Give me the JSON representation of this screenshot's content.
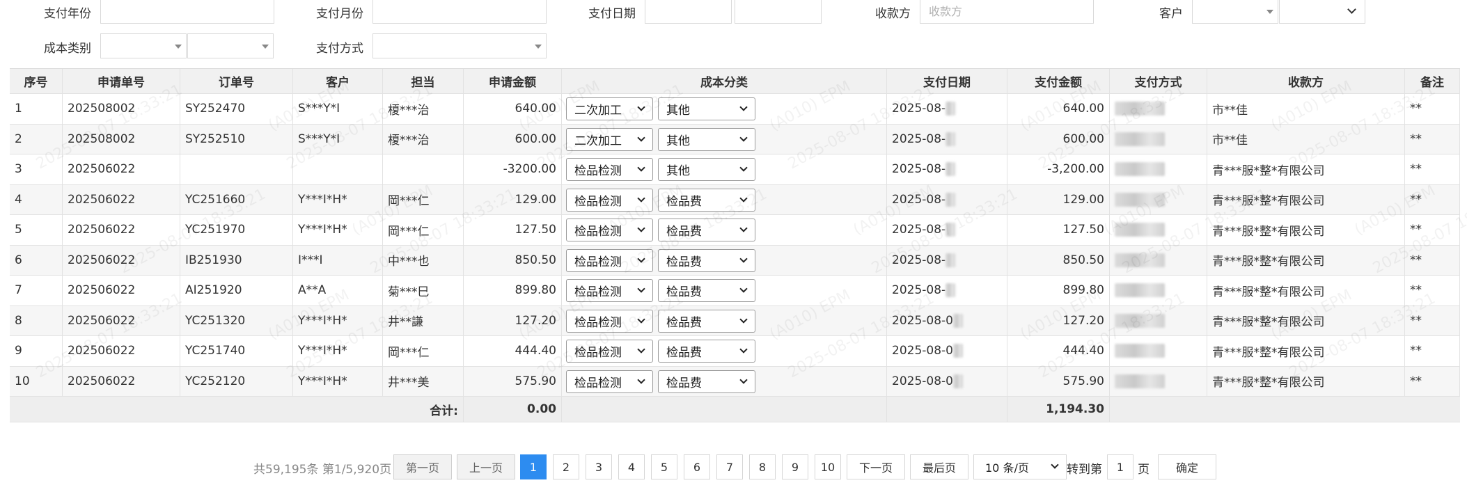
{
  "filters": {
    "pay_year_label": "支付年份",
    "pay_month_label": "支付月份",
    "pay_date_label": "支付日期",
    "payee_label": "收款方",
    "payee_placeholder": "收款方",
    "customer_label": "客户",
    "cost_category_label": "成本类别",
    "pay_method_label": "支付方式"
  },
  "table": {
    "headers": [
      "序号",
      "申请单号",
      "订单号",
      "客户",
      "担当",
      "申请金额",
      "成本分类",
      "支付日期",
      "支付金额",
      "支付方式",
      "收款方",
      "备注"
    ],
    "rows": [
      {
        "no": "1",
        "app_no": "202508002",
        "order_no": "SY252470",
        "customer": "S***Y*I",
        "owner": "榎***治",
        "amount": "640.00",
        "cat1": "二次加工",
        "cat2": "其他",
        "date": "2025-08-",
        "pay_amount": "640.00",
        "payee": "市**佳",
        "remark": "**"
      },
      {
        "no": "2",
        "app_no": "202508002",
        "order_no": "SY252510",
        "customer": "S***Y*I",
        "owner": "榎***治",
        "amount": "600.00",
        "cat1": "二次加工",
        "cat2": "其他",
        "date": "2025-08-",
        "pay_amount": "600.00",
        "payee": "市**佳",
        "remark": "**"
      },
      {
        "no": "3",
        "app_no": "202506022",
        "order_no": "",
        "customer": "",
        "owner": "",
        "amount": "-3200.00",
        "cat1": "检品检测",
        "cat2": "其他",
        "date": "2025-08-",
        "pay_amount": "-3,200.00",
        "payee": "青***服*整*有限公司",
        "remark": "**"
      },
      {
        "no": "4",
        "app_no": "202506022",
        "order_no": "YC251660",
        "customer": "Y***I*H*",
        "owner": "岡***仁",
        "amount": "129.00",
        "cat1": "检品检测",
        "cat2": "检品费",
        "date": "2025-08-",
        "pay_amount": "129.00",
        "payee": "青***服*整*有限公司",
        "remark": "**"
      },
      {
        "no": "5",
        "app_no": "202506022",
        "order_no": "YC251970",
        "customer": "Y***I*H*",
        "owner": "岡***仁",
        "amount": "127.50",
        "cat1": "检品检测",
        "cat2": "检品费",
        "date": "2025-08-",
        "pay_amount": "127.50",
        "payee": "青***服*整*有限公司",
        "remark": "**"
      },
      {
        "no": "6",
        "app_no": "202506022",
        "order_no": "IB251930",
        "customer": "I***I",
        "owner": "中***也",
        "amount": "850.50",
        "cat1": "检品检测",
        "cat2": "检品费",
        "date": "2025-08-",
        "pay_amount": "850.50",
        "payee": "青***服*整*有限公司",
        "remark": "**"
      },
      {
        "no": "7",
        "app_no": "202506022",
        "order_no": "AI251920",
        "customer": "A**A",
        "owner": "菊***巳",
        "amount": "899.80",
        "cat1": "检品检测",
        "cat2": "检品费",
        "date": "2025-08-",
        "pay_amount": "899.80",
        "payee": "青***服*整*有限公司",
        "remark": "**"
      },
      {
        "no": "8",
        "app_no": "202506022",
        "order_no": "YC251320",
        "customer": "Y***I*H*",
        "owner": "井**謙",
        "amount": "127.20",
        "cat1": "检品检测",
        "cat2": "检品费",
        "date": "2025-08-0",
        "pay_amount": "127.20",
        "payee": "青***服*整*有限公司",
        "remark": "**"
      },
      {
        "no": "9",
        "app_no": "202506022",
        "order_no": "YC251740",
        "customer": "Y***I*H*",
        "owner": "岡***仁",
        "amount": "444.40",
        "cat1": "检品检测",
        "cat2": "检品费",
        "date": "2025-08-0",
        "pay_amount": "444.40",
        "payee": "青***服*整*有限公司",
        "remark": "**"
      },
      {
        "no": "10",
        "app_no": "202506022",
        "order_no": "YC252120",
        "customer": "Y***I*H*",
        "owner": "井***美",
        "amount": "575.90",
        "cat1": "检品检测",
        "cat2": "检品费",
        "date": "2025-08-0",
        "pay_amount": "575.90",
        "payee": "青***服*整*有限公司",
        "remark": "**"
      }
    ],
    "total_label": "合计:",
    "total_amount": "0.00",
    "total_pay_amount": "1,194.30"
  },
  "watermark": {
    "stamp": "(A010) EPM",
    "time": "2025-08-07 18:33:21"
  },
  "pager": {
    "summary": "共59,195条 第1/5,920页",
    "first": "第一页",
    "prev": "上一页",
    "pages": [
      "1",
      "2",
      "3",
      "4",
      "5",
      "6",
      "7",
      "8",
      "9",
      "10"
    ],
    "active_page": "1",
    "next": "下一页",
    "last": "最后页",
    "page_size": "10 条/页",
    "goto_label": "转到第",
    "goto_value": "1",
    "page_unit": "页",
    "confirm": "确定"
  }
}
